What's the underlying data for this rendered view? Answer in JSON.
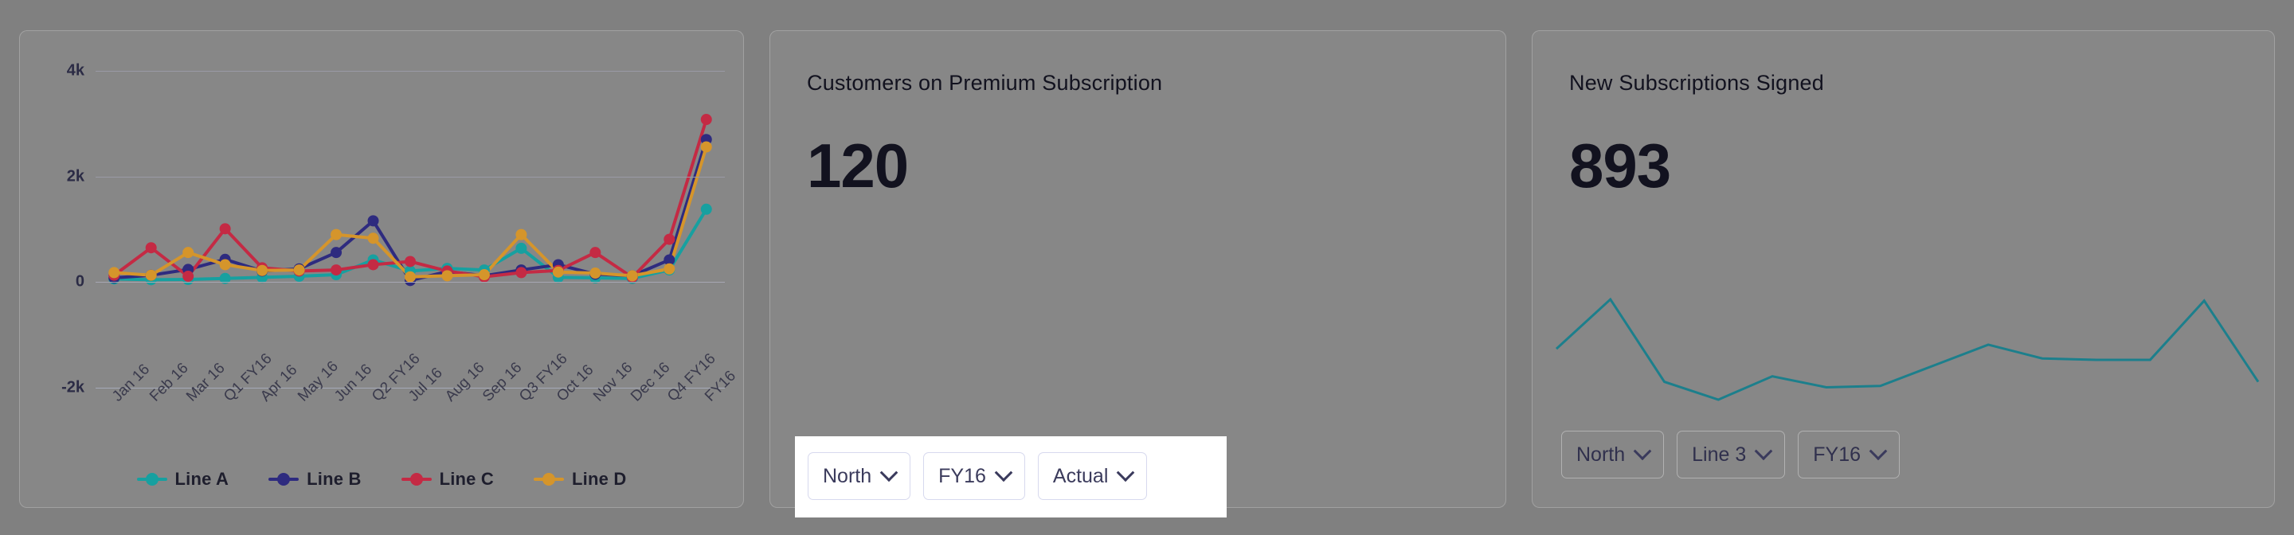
{
  "colors": {
    "line_a": "#17a0a0",
    "line_b": "#2e2b7f",
    "line_c": "#c42a44",
    "line_d": "#d5952b",
    "spark": "#1c7f8c",
    "text": "#12121f",
    "dim_background": "#808080",
    "spotlight_background": "#ffffff"
  },
  "cards": [
    {
      "id": "multi-line-chart",
      "legend": [
        {
          "label": "Line A",
          "color": "#17a0a0"
        },
        {
          "label": "Line B",
          "color": "#2e2b7f"
        },
        {
          "label": "Line C",
          "color": "#c42a44"
        },
        {
          "label": "Line D",
          "color": "#d5952b"
        }
      ]
    },
    {
      "id": "customers-premium",
      "title": "Customers on Premium Subscription",
      "value": "120",
      "dropdowns": [
        {
          "label": "North"
        },
        {
          "label": "FY16"
        },
        {
          "label": "Actual"
        }
      ]
    },
    {
      "id": "new-subscriptions",
      "title": "New Subscriptions Signed",
      "value": "893",
      "dropdowns": [
        {
          "label": "North"
        },
        {
          "label": "Line 3"
        },
        {
          "label": "FY16"
        }
      ]
    }
  ],
  "chart_data": [
    {
      "type": "line",
      "title": "",
      "xlabel": "",
      "ylabel": "",
      "ylim": [
        -2000,
        4000
      ],
      "yticks": [
        4000,
        2000,
        0,
        -2000
      ],
      "ytick_labels": [
        "4k",
        "2k",
        "0",
        "-2k"
      ],
      "grid": true,
      "legend_position": "bottom",
      "markers": true,
      "categories": [
        "Jan 16",
        "Feb 16",
        "Mar 16",
        "Q1 FY16",
        "Apr 16",
        "May 16",
        "Jun 16",
        "Q2 FY16",
        "Jul 16",
        "Aug 16",
        "Sep 16",
        "Q3 FY16",
        "Oct 16",
        "Nov 16",
        "Dec 16",
        "Q4 FY16",
        "FY16"
      ],
      "series": [
        {
          "name": "Line A",
          "color": "#17a0a0",
          "values": [
            60,
            45,
            50,
            70,
            90,
            110,
            140,
            420,
            210,
            260,
            230,
            640,
            90,
            80,
            70,
            230,
            1380
          ]
        },
        {
          "name": "Line B",
          "color": "#2e2b7f",
          "values": [
            80,
            130,
            240,
            430,
            210,
            250,
            560,
            1160,
            30,
            200,
            120,
            230,
            330,
            150,
            120,
            420,
            2700
          ]
        },
        {
          "name": "Line C",
          "color": "#c42a44",
          "values": [
            130,
            650,
            110,
            1010,
            270,
            210,
            230,
            330,
            390,
            210,
            100,
            180,
            220,
            560,
            90,
            810,
            3080
          ]
        },
        {
          "name": "Line D",
          "color": "#d5952b",
          "values": [
            180,
            130,
            560,
            330,
            220,
            230,
            900,
            830,
            100,
            120,
            140,
            900,
            190,
            170,
            120,
            250,
            2560
          ]
        }
      ]
    },
    {
      "type": "line",
      "title": "New Subscriptions Signed",
      "xlabel": "",
      "ylabel": "",
      "grid": false,
      "markers": false,
      "series": [
        {
          "name": "Line 3",
          "color": "#1c7f8c",
          "values": [
            42,
            78,
            18,
            5,
            22,
            14,
            15,
            30,
            45,
            35,
            34,
            34,
            77,
            18
          ]
        }
      ]
    }
  ]
}
